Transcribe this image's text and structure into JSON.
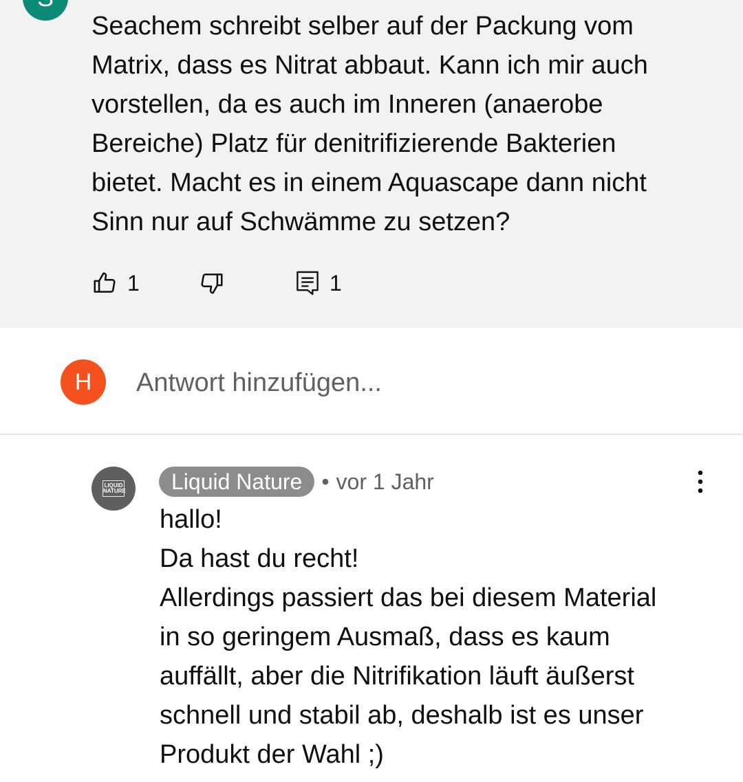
{
  "top_comment": {
    "avatar_letter": "S",
    "text": "Seachem schreibt selber auf der Packung vom\nMatrix, dass es Nitrat abbaut. Kann ich mir auch\nvorstellen, da es auch im Inneren (anaerobe\nBereiche) Platz für denitrifizierende Bakterien\nbietet. Macht es in einem Aquascape dann nicht\nSinn nur auf Schwämme zu setzen?",
    "like_count": "1",
    "reply_count": "1",
    "icons": {
      "like": "thumbs-up-icon",
      "dislike": "thumbs-down-icon",
      "reply": "comment-reply-icon"
    }
  },
  "add_reply": {
    "avatar_letter": "H",
    "placeholder": "Antwort hinzufügen...",
    "avatar_color": "#f4511e"
  },
  "reply": {
    "author": "Liquid Nature",
    "separator": "•",
    "time": "vor 1 Jahr",
    "logo_line1": "LIQUID",
    "logo_line2": "NATURE",
    "text": "hallo!\nDa hast du recht!\nAllerdings passiert das bei diesem Material\nin so geringem Ausmaß, dass es kaum\nauffällt, aber die Nitrifikation läuft äußerst\nschnell und stabil ab, deshalb ist es unser\nProdukt der Wahl ;)"
  },
  "colors": {
    "top_background": "#f2f2f2",
    "author_chip": "#8c8c8c",
    "top_avatar": "#0b8a78",
    "meta_text": "#606060"
  }
}
